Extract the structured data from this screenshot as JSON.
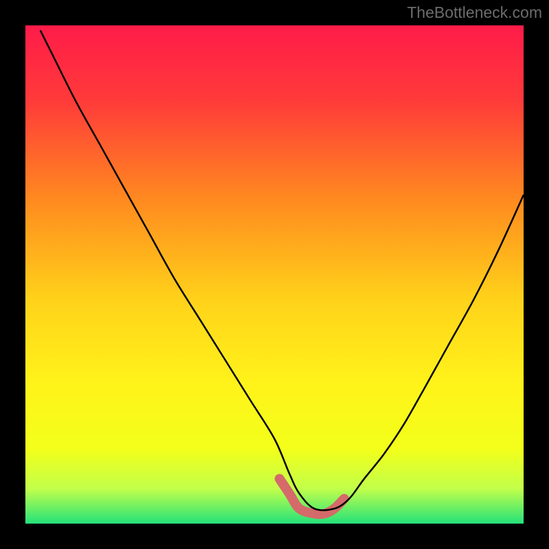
{
  "watermark": "TheBottleneck.com",
  "chart_data": {
    "type": "line",
    "title": "",
    "xlabel": "",
    "ylabel": "",
    "xlim": [
      0,
      100
    ],
    "ylim": [
      0,
      100
    ],
    "description": "Bottleneck curve showing a valley/dip pattern where optimal point is near x=55-60. Background is a vertical gradient from red (high bottleneck) through orange, yellow (mid) to green (low/good) at bottom.",
    "series": [
      {
        "name": "bottleneck-curve",
        "x": [
          3,
          5,
          10,
          15,
          20,
          25,
          30,
          35,
          40,
          45,
          50,
          53,
          55,
          58,
          62,
          65,
          68,
          72,
          76,
          80,
          85,
          90,
          95,
          100
        ],
        "y": [
          99,
          95,
          85,
          76,
          67,
          58,
          49,
          41,
          33,
          25,
          17,
          10,
          6,
          3,
          3,
          5,
          9,
          14,
          20,
          27,
          36,
          45,
          55,
          66
        ]
      },
      {
        "name": "highlight-band",
        "x": [
          51,
          53,
          55,
          58,
          60,
          62,
          64
        ],
        "y": [
          9,
          6,
          3,
          2,
          2,
          3,
          5
        ]
      }
    ],
    "gradient_stops": [
      {
        "offset": 0,
        "color": "#ff1c49"
      },
      {
        "offset": 15,
        "color": "#ff3a3a"
      },
      {
        "offset": 35,
        "color": "#ff8a1f"
      },
      {
        "offset": 55,
        "color": "#ffd21a"
      },
      {
        "offset": 72,
        "color": "#fff31a"
      },
      {
        "offset": 85,
        "color": "#f3ff1a"
      },
      {
        "offset": 93,
        "color": "#c2ff4a"
      },
      {
        "offset": 100,
        "color": "#24e27a"
      }
    ],
    "highlight_color": "#d46a6a"
  }
}
